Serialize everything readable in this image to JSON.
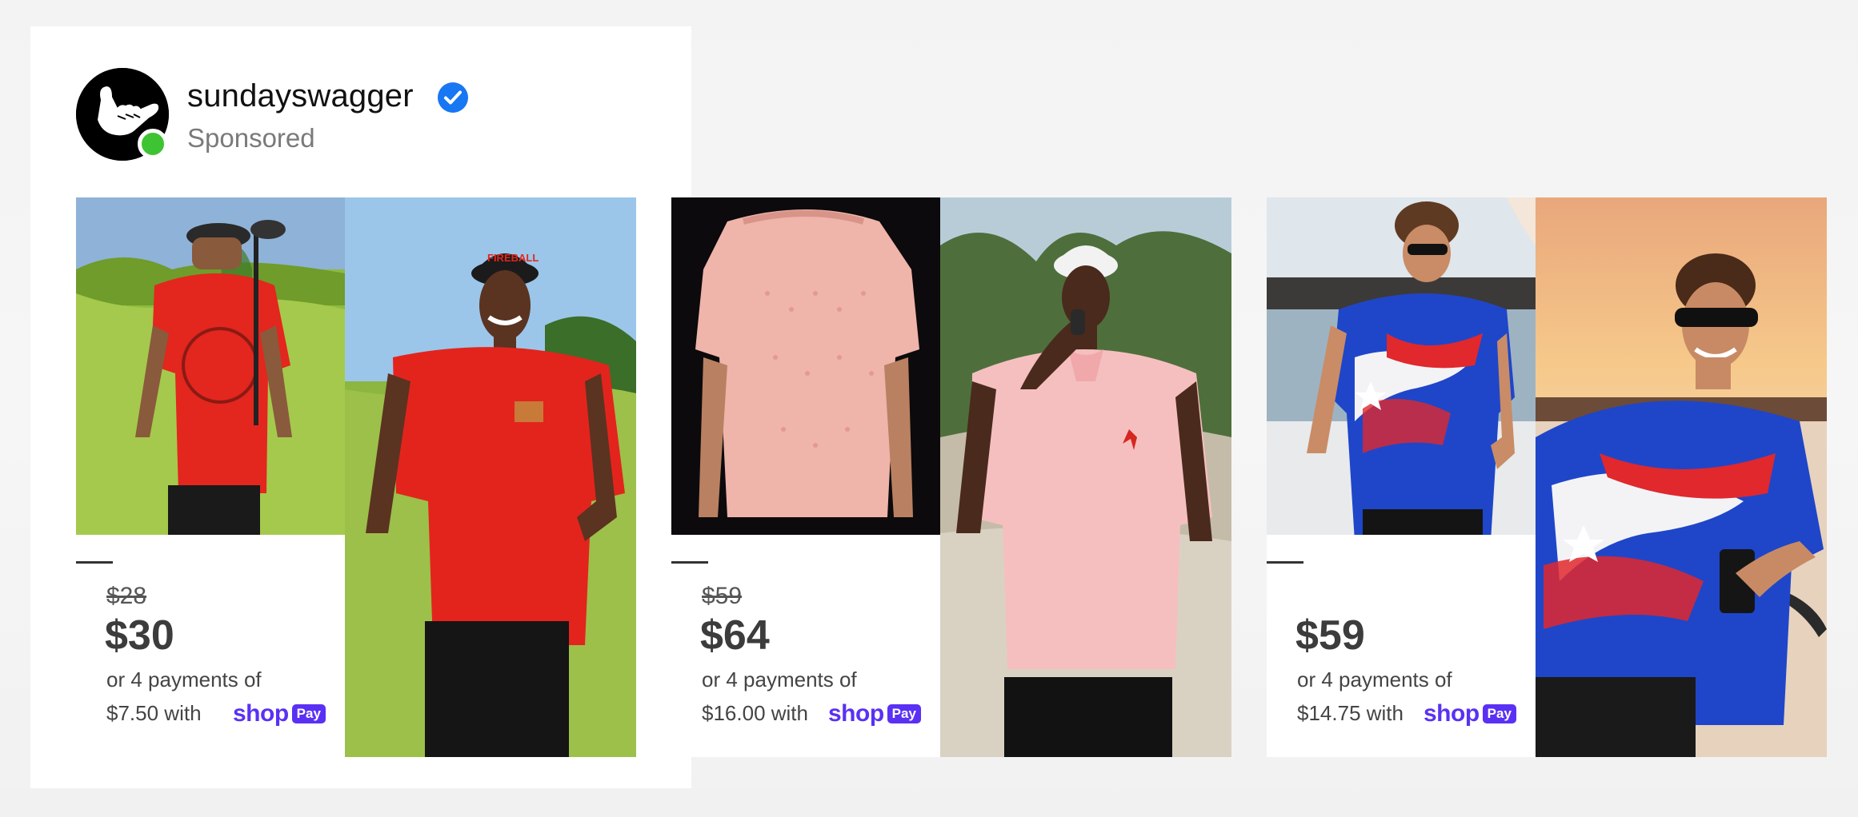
{
  "ad": {
    "brand_name": "sundayswagger",
    "sponsored_label": "Sponsored"
  },
  "products": [
    {
      "original_price": "$28",
      "price": "$30",
      "installment_line": "or 4 payments of",
      "installment_amount": "$7.50 with",
      "payment_provider": "shop",
      "payment_badge": "Pay"
    },
    {
      "original_price": "$59",
      "price": "$64",
      "installment_line": "or 4 payments of",
      "installment_amount": "$16.00 with",
      "payment_provider": "shop",
      "payment_badge": "Pay"
    },
    {
      "original_price": "",
      "price": "$59",
      "installment_line": "or 4 payments of",
      "installment_amount": "$14.75 with",
      "payment_provider": "shop",
      "payment_badge": "Pay"
    }
  ],
  "colors": {
    "shop_pay_purple": "#5a31f4",
    "verified_blue": "#1877f2",
    "online_green": "#3ec433"
  },
  "icons": [
    "shaka-hand-icon",
    "verified-badge-icon",
    "online-status-icon"
  ]
}
